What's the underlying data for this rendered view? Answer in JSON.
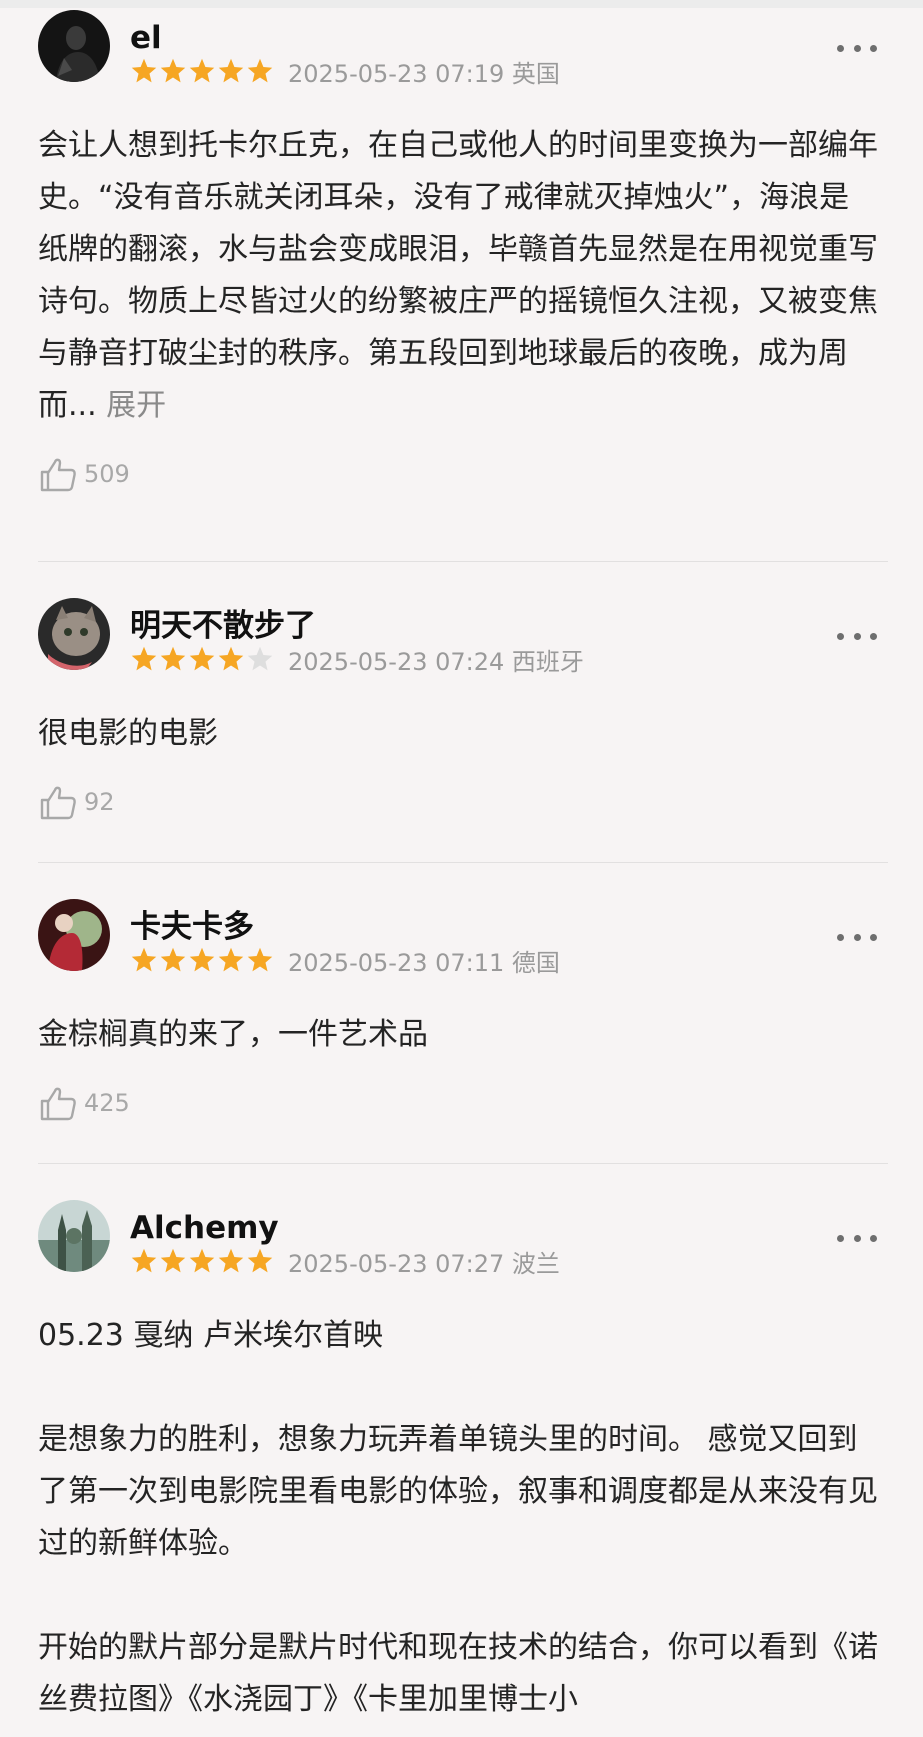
{
  "reviews": [
    {
      "user": "el",
      "rating": 5,
      "meta": "2025-05-23 07:19 英国",
      "paragraphs": [
        "会让人想到托卡尔丘克，在自己或他人的时间里变换为一部编年史。“没有音乐就关闭耳朵，没有了戒律就灭掉烛火”，海浪是纸牌的翻滚，水与盐会变成眼泪，毕赣首先显然是在用视觉重写诗句。物质上尽皆过火的纷繁被庄严的摇镜恒久注视，又被变焦与静音打破尘封的秩序。第五段回到地球最后的夜晚，成为周而..."
      ],
      "expand": "展开",
      "likes": "509",
      "avatar_icon": "avatar-dark-portrait"
    },
    {
      "user": "明天不散步了",
      "rating": 4,
      "meta": "2025-05-23 07:24 西班牙",
      "paragraphs": [
        "很电影的电影"
      ],
      "likes": "92",
      "avatar_icon": "avatar-cat"
    },
    {
      "user": "卡夫卡多",
      "rating": 5,
      "meta": "2025-05-23 07:11 德国",
      "paragraphs": [
        "金棕榈真的来了，一件艺术品"
      ],
      "likes": "425",
      "avatar_icon": "avatar-painting"
    },
    {
      "user": "Alchemy",
      "rating": 5,
      "meta": "2025-05-23 07:27 波兰",
      "paragraphs": [
        "05.23 戛纳 卢米埃尔首映",
        "是想象力的胜利，想象力玩弄着单镜头里的时间。 感觉又回到了第一次到电影院里看电影的体验，叙事和调度都是从来没有见过的新鲜体验。",
        "开始的默片部分是默片时代和现在技术的结合，你可以看到《诺丝费拉图》《水浇园丁》《卡里加里博士小"
      ],
      "avatar_icon": "avatar-landscape"
    }
  ],
  "colors": {
    "star_filled": "#f6a623",
    "star_empty": "#dedede",
    "background": "#f7f4f4",
    "meta_text": "#9a9a9a"
  }
}
